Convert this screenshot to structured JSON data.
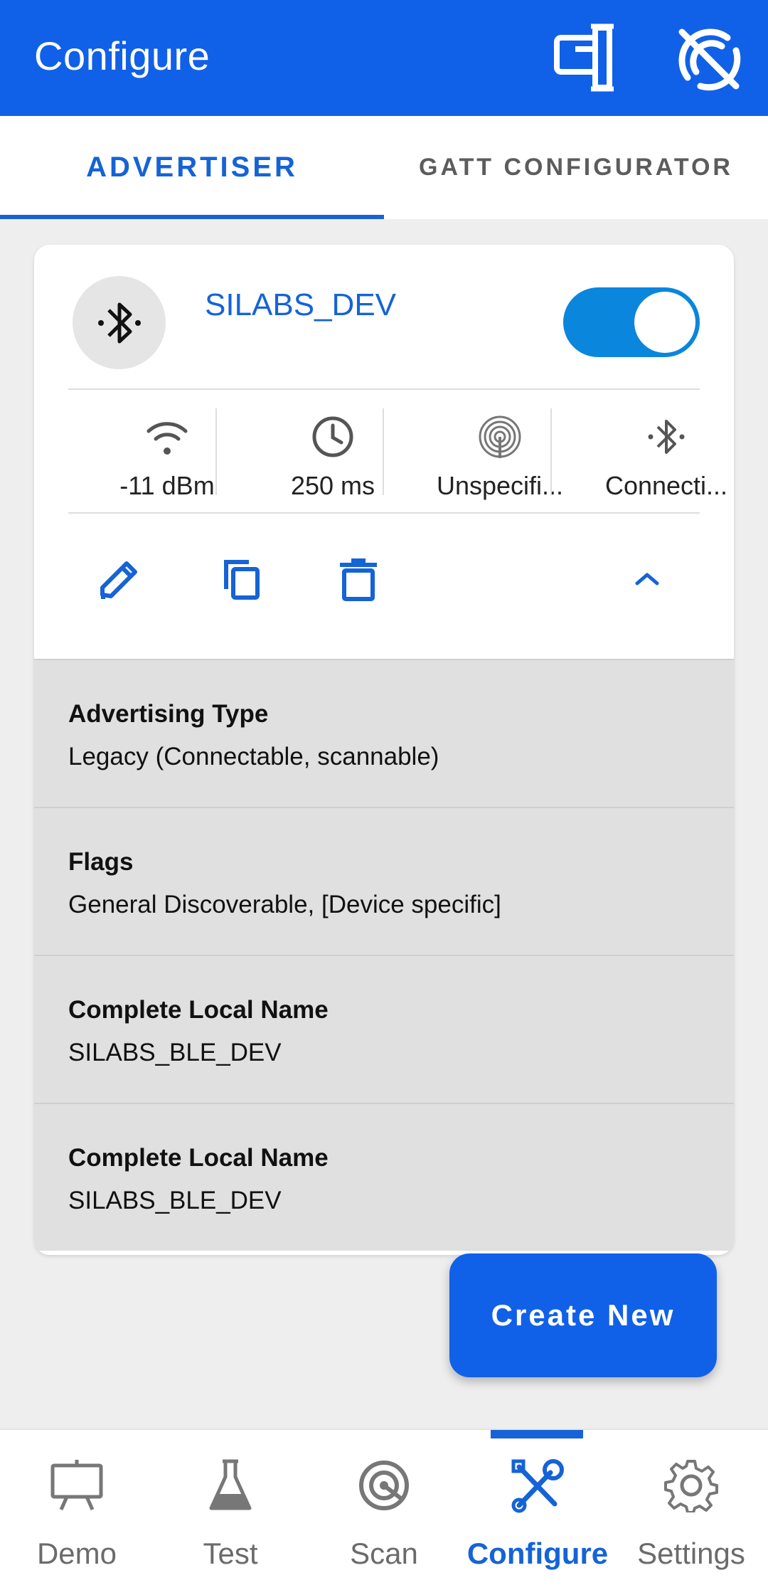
{
  "appbar": {
    "title": "Configure",
    "icons": [
      "devices-icon",
      "bluetooth-disabled-icon"
    ]
  },
  "tabs": [
    {
      "label": "ADVERTISER",
      "active": true
    },
    {
      "label": "GATT CONFIGURATOR",
      "active": false
    }
  ],
  "advertiser": {
    "name": "SILABS_DEV",
    "enabled": true,
    "stats": [
      {
        "icon": "wifi-signal-icon",
        "value": "-11 dBm"
      },
      {
        "icon": "clock-icon",
        "value": "250 ms"
      },
      {
        "icon": "antenna-icon",
        "value": "Unspecifi..."
      },
      {
        "icon": "bluetooth-icon",
        "value": "Connecti..."
      }
    ],
    "actions": [
      "edit-icon",
      "copy-icon",
      "delete-icon",
      "chevron-up-icon"
    ],
    "details": [
      {
        "label": "Advertising Type",
        "value": "Legacy (Connectable, scannable)"
      },
      {
        "label": "Flags",
        "value": "General Discoverable, [Device specific]"
      },
      {
        "label": "Complete Local Name",
        "value": "SILABS_BLE_DEV"
      },
      {
        "label": "Complete Local Name",
        "value": "SILABS_BLE_DEV"
      }
    ]
  },
  "fab": {
    "label": "Create New"
  },
  "bottom_nav": [
    {
      "label": "Demo",
      "icon": "presentation-icon",
      "active": false
    },
    {
      "label": "Test",
      "icon": "flask-icon",
      "active": false
    },
    {
      "label": "Scan",
      "icon": "scan-icon",
      "active": false
    },
    {
      "label": "Configure",
      "icon": "tools-icon",
      "active": true
    },
    {
      "label": "Settings",
      "icon": "gear-icon",
      "active": false
    }
  ],
  "colors": {
    "primary": "#1160e8",
    "accent_text": "#1563d6",
    "toggle_on": "#0a86dc",
    "background": "#efeeef",
    "detail_background": "#e0e0e0"
  }
}
